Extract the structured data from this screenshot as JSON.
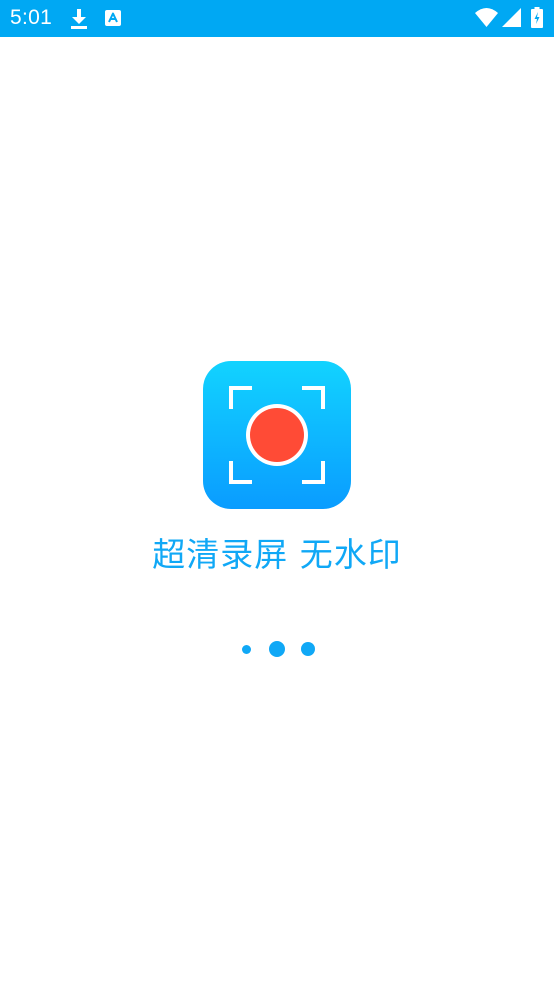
{
  "status_bar": {
    "time": "5:01",
    "icons": [
      "download-icon",
      "app-a-icon",
      "wifi-icon",
      "signal-icon",
      "battery-icon"
    ],
    "background_color": "#00a8f3"
  },
  "splash": {
    "logo": {
      "icon": "screen-record-icon",
      "gradient_colors": [
        "#12d3ff",
        "#0a9cff"
      ],
      "record_color": "#ff4b36"
    },
    "tagline": "超清录屏 无水印",
    "tagline_color": "#10a8f6",
    "loading_indicator": {
      "dots": 3,
      "color": "#10a8f6"
    }
  }
}
